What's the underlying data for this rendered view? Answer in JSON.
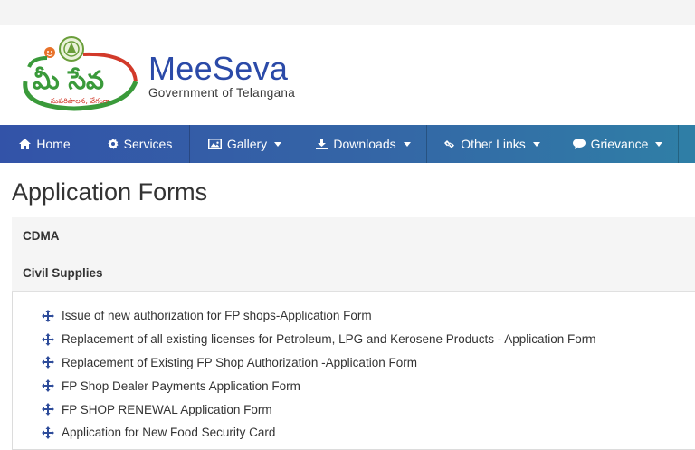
{
  "brand": {
    "logo_text": "మీ సేవ",
    "logo_tagline": "సుపరిపాలన, వేగంగా",
    "name": "MeeSeva",
    "subtitle": "Government of Telangana"
  },
  "nav": {
    "items": [
      {
        "label": "Home",
        "icon": "home-icon",
        "dropdown": false
      },
      {
        "label": "Services",
        "icon": "gear-icon",
        "dropdown": false
      },
      {
        "label": "Gallery",
        "icon": "image-icon",
        "dropdown": true
      },
      {
        "label": "Downloads",
        "icon": "download-icon",
        "dropdown": true
      },
      {
        "label": "Other Links",
        "icon": "link-icon",
        "dropdown": true
      },
      {
        "label": "Grievance",
        "icon": "comment-icon",
        "dropdown": true
      }
    ]
  },
  "page": {
    "title": "Application Forms",
    "sections": [
      {
        "label": "CDMA"
      },
      {
        "label": "Civil Supplies"
      }
    ],
    "forms": [
      "Issue of new authorization for FP shops-Application Form",
      "Replacement of all existing licenses for Petroleum, LPG and Kerosene Products - Application Form",
      "Replacement of Existing FP Shop Authorization -Application Form",
      "FP Shop Dealer Payments Application Form",
      "FP SHOP RENEWAL Application Form",
      "Application for New Food Security Card"
    ]
  },
  "colors": {
    "navbar_start": "#3353a8",
    "navbar_end": "#2f7fa6",
    "brand_blue": "#2b4aa8",
    "logo_green": "#3a9a3a",
    "logo_red": "#d23a2a",
    "bullet_blue": "#2e4c9a"
  }
}
